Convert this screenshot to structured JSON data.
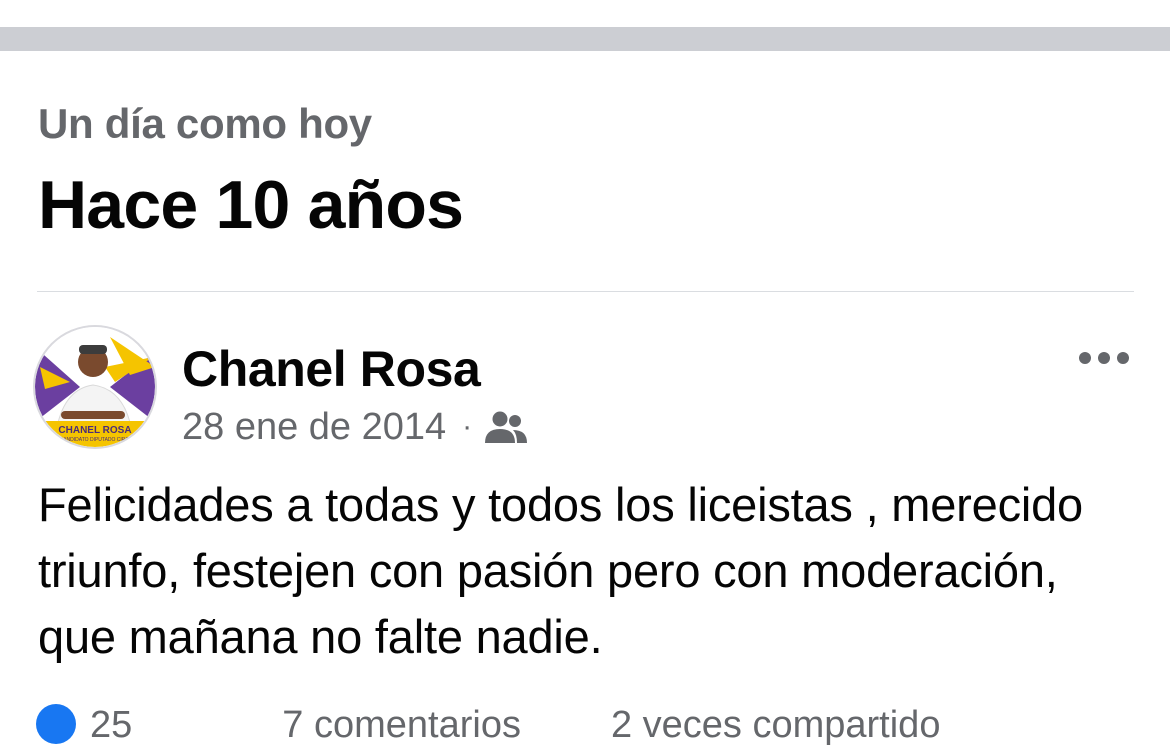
{
  "memory": {
    "subtitle": "Un día como hoy",
    "title": "Hace 10 años"
  },
  "post": {
    "author": "Chanel Rosa",
    "date": "28 ene de 2014",
    "separator": "·",
    "audience_icon": "friends-icon",
    "more_icon": "more-horizontal-icon",
    "text": "Felicidades a todas y todos los liceistas , merecido triunfo, festejen con pasión pero con moderación, que mañana no falte nadie.",
    "avatar": {
      "banner_line1": "CHANEL ROSA",
      "banner_line2": "CANDIDATO DIPUTADO CIRC.",
      "colors": {
        "purple": "#6b3fa0",
        "yellow": "#f5c400"
      }
    },
    "reactions": {
      "like_icon": "like-badge-icon",
      "count": "25",
      "comments": "7 comentarios",
      "shares": "2 veces compartido"
    }
  },
  "colors": {
    "band": "#ccced3",
    "secondary_text": "#65676b",
    "primary_text": "#050505",
    "like_blue": "#1877f2"
  }
}
